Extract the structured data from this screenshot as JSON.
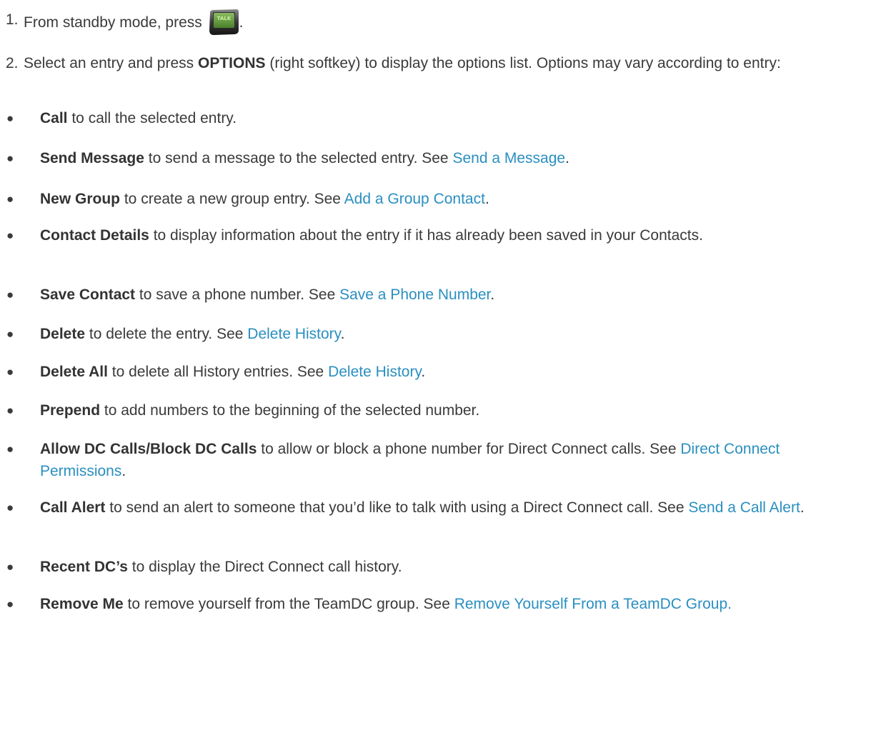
{
  "steps": [
    {
      "number": "1.",
      "text": "From standby mode, press",
      "after_icon": "."
    },
    {
      "number": "2.",
      "text_before": "Select an entry and press ",
      "bold": "OPTIONS",
      "text_after": " (right softkey) to display the options list. Options may vary according to entry:"
    }
  ],
  "talk_key": {
    "label": "TALK",
    "icon": "talk-key-icon",
    "color": "#6db33f"
  },
  "bullet_char": "●",
  "options": [
    {
      "bold": "Call",
      "text": " to call the selected entry."
    },
    {
      "bold": "Send Message",
      "text": " to send a message to the selected entry. See ",
      "link": "Send a Message",
      "tail": "."
    },
    {
      "bold": "New Group",
      "text": " to create a new group entry. See ",
      "link": "Add a Group Contact",
      "tail": "."
    },
    {
      "bold": "Contact Details",
      "text": " to display information about the entry if it has already been saved in your Contacts."
    },
    {
      "bold": "Save Contact",
      "text": " to save a phone number. See ",
      "link": "Save a Phone Number",
      "tail": "."
    },
    {
      "bold": "Delete",
      "text": " to delete the entry. See ",
      "link": "Delete History",
      "tail": "."
    },
    {
      "bold": "Delete All",
      "text": " to delete all History entries. See ",
      "link": "Delete History",
      "tail": "."
    },
    {
      "bold": "Prepend",
      "text": " to add numbers to the beginning of the selected number."
    },
    {
      "bold": "Allow DC Calls/Block DC Calls",
      "text": " to allow or block a phone number for Direct Connect calls. See ",
      "link": "Direct Connect Permissions",
      "tail": "."
    },
    {
      "bold": "Call Alert",
      "text": " to send an alert to someone that you’d like to talk with using a Direct Connect call. See ",
      "link": "Send a Call Alert",
      "tail": "."
    },
    {
      "bold": "Recent DC’s",
      "text": " to display the Direct Connect call history."
    },
    {
      "bold": "Remove Me",
      "text": " to remove yourself from the TeamDC group. See ",
      "link": "Remove Yourself From a TeamDC Group.",
      "tail": ""
    }
  ]
}
